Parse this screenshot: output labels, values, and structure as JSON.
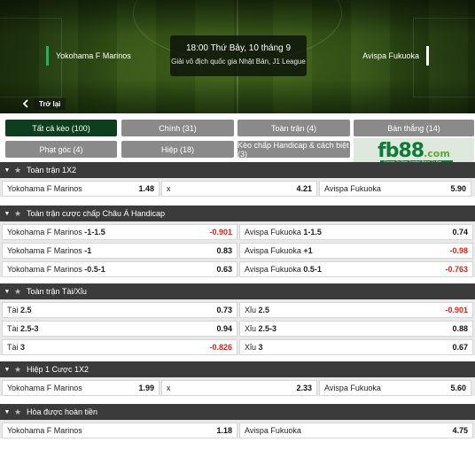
{
  "match": {
    "home_team": "Yokohama F Marinos",
    "away_team": "Avispa Fukuoka",
    "time": "18:00 Thứ Bảy, 10 tháng 9",
    "league": "Giải vô địch quốc gia Nhật Bản, J1 League",
    "back_label": "Trở lại"
  },
  "tabs": [
    {
      "label": "Tất cả kèo (100)",
      "active": true
    },
    {
      "label": "Chính (31)",
      "active": false
    },
    {
      "label": "Toàn trận (4)",
      "active": false
    },
    {
      "label": "Bàn thắng (14)",
      "active": false
    },
    {
      "label": "Phạt góc (4)",
      "active": false
    },
    {
      "label": "Hiệp (18)",
      "active": false
    },
    {
      "label": "Kèo chấp Handicap & cách biệt (3)",
      "active": false
    }
  ],
  "promo": {
    "logo_main": "fb88",
    "logo_suffix": ".com",
    "tagline": "Games To Play  Trusted Place To Bet"
  },
  "colors": {
    "active_tab": "#0d3f1e",
    "tab": "#8a8a8a",
    "section_header": "#3b3b3b",
    "negative_odds": "#e0201a",
    "brand": "#0e7a37"
  },
  "markets": [
    {
      "title": "Toàn trận 1X2",
      "rows": [
        [
          {
            "label": "Yokohama F Marinos",
            "line": "",
            "odd": "1.48",
            "negative": false
          },
          {
            "label": "x",
            "line": "",
            "odd": "4.21",
            "negative": false
          },
          {
            "label": "Avispa Fukuoka",
            "line": "",
            "odd": "5.90",
            "negative": false
          }
        ]
      ]
    },
    {
      "title": "Toàn trận cược chấp Châu Á Handicap",
      "rows": [
        [
          {
            "label": "Yokohama F Marinos",
            "line": "-1-1.5",
            "odd": "-0.901",
            "negative": true
          },
          {
            "label": "Avispa Fukuoka",
            "line": "1-1.5",
            "odd": "0.74",
            "negative": false
          }
        ],
        [
          {
            "label": "Yokohama F Marinos",
            "line": "-1",
            "odd": "0.83",
            "negative": false
          },
          {
            "label": "Avispa Fukuoka",
            "line": "+1",
            "odd": "-0.98",
            "negative": true
          }
        ],
        [
          {
            "label": "Yokohama F Marinos",
            "line": "-0.5-1",
            "odd": "0.63",
            "negative": false
          },
          {
            "label": "Avispa Fukuoka",
            "line": "0.5-1",
            "odd": "-0.763",
            "negative": true
          }
        ]
      ]
    },
    {
      "title": "Toàn trận Tài/Xỉu",
      "rows": [
        [
          {
            "label": "Tài",
            "line": "2.5",
            "odd": "0.73",
            "negative": false
          },
          {
            "label": "Xỉu",
            "line": "2.5",
            "odd": "-0.901",
            "negative": true
          }
        ],
        [
          {
            "label": "Tài",
            "line": "2.5-3",
            "odd": "0.94",
            "negative": false
          },
          {
            "label": "Xỉu",
            "line": "2.5-3",
            "odd": "0.88",
            "negative": false
          }
        ],
        [
          {
            "label": "Tài",
            "line": "3",
            "odd": "-0.826",
            "negative": true
          },
          {
            "label": "Xỉu",
            "line": "3",
            "odd": "0.67",
            "negative": false
          }
        ]
      ]
    },
    {
      "title": "Hiệp 1 Cược 1X2",
      "rows": [
        [
          {
            "label": "Yokohama F Marinos",
            "line": "",
            "odd": "1.99",
            "negative": false
          },
          {
            "label": "x",
            "line": "",
            "odd": "2.33",
            "negative": false
          },
          {
            "label": "Avispa Fukuoka",
            "line": "",
            "odd": "5.60",
            "negative": false
          }
        ]
      ]
    },
    {
      "title": "Hòa được hoàn tiền",
      "rows": [
        [
          {
            "label": "Yokohama F Marinos",
            "line": "",
            "odd": "1.18",
            "negative": false
          },
          {
            "label": "Avispa Fukuoka",
            "line": "",
            "odd": "4.75",
            "negative": false
          }
        ]
      ]
    }
  ]
}
